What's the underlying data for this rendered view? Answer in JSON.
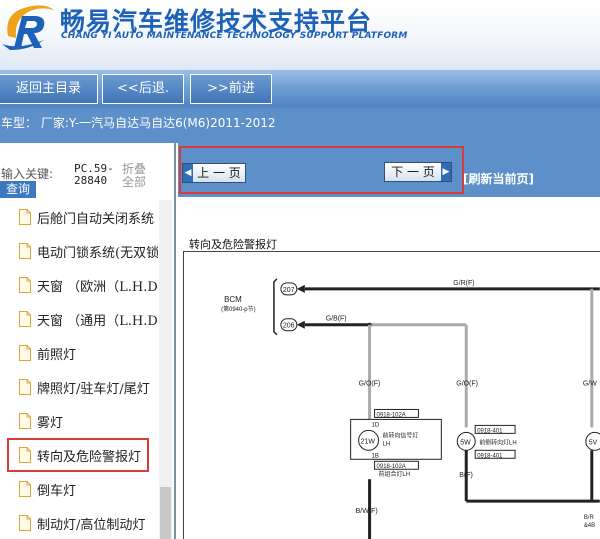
{
  "header": {
    "title_cn": "畅易汽车维修技术支持平台",
    "title_en": "CHANG YI AUTO MAINTENANCE TECHNOLOGY SUPPORT PLATFORM"
  },
  "nav": {
    "home_label": "返回主目录",
    "back_label": "<<后退.",
    "forward_label": ">>前进"
  },
  "car_info": "车型： 厂家:Y-一汽马自达马自达6(M6)2011-2012",
  "search": {
    "hint": "输入关键:",
    "button_label": "查询",
    "pc_line1": "PC.59-",
    "pc_line2": "28840",
    "fold_line1": "折叠",
    "fold_line2": "全部"
  },
  "sidebar": {
    "items": [
      {
        "label": "后舱门自动关闭系统"
      },
      {
        "label": "电动门锁系统(无双锁"
      },
      {
        "label": "天窗  （欧洲（L.H.D."
      },
      {
        "label": "天窗  （通用（L.H.D."
      },
      {
        "label": "前照灯"
      },
      {
        "label": "牌照灯/驻车灯/尾灯"
      },
      {
        "label": "雾灯"
      },
      {
        "label": "转向及危险警报灯"
      },
      {
        "label": "倒车灯"
      },
      {
        "label": "制动灯/高位制动灯"
      }
    ]
  },
  "pager": {
    "prev_label": "上 一 页",
    "next_label": "下 一 页",
    "refresh_label": "[刷新当前页]"
  },
  "diagram": {
    "title": "转向及危险警报灯",
    "bcm_label": "BCM",
    "bcm_sub": "(第0940-p节)",
    "pin_207": "207",
    "pin_206": "206",
    "wire_gr": "G/R(F)",
    "wire_gb": "G/B(F)",
    "wire_go": "G/O(F)",
    "wire_gw": "G/W",
    "conn_1": "0918-102A",
    "pin_1d": "1D",
    "pin_1b": "1B",
    "bulb_21w": "21W",
    "lamp_front_signal": "前转向信号灯",
    "lamp_front_signal_side": "LH",
    "conn_2": "0918-102A",
    "lamp_front_combo": "前组合灯LH",
    "conn_3": "0918-401",
    "bulb_5w": "5W",
    "lamp_side_signal": "前侧转向灯LH",
    "conn_4": "0918-401",
    "bulb_5w_right": "5V",
    "wire_bf": "B(F)",
    "wire_bwf": "B/W(F)",
    "wire_br": "B/R",
    "wire_4b": "&4B"
  }
}
